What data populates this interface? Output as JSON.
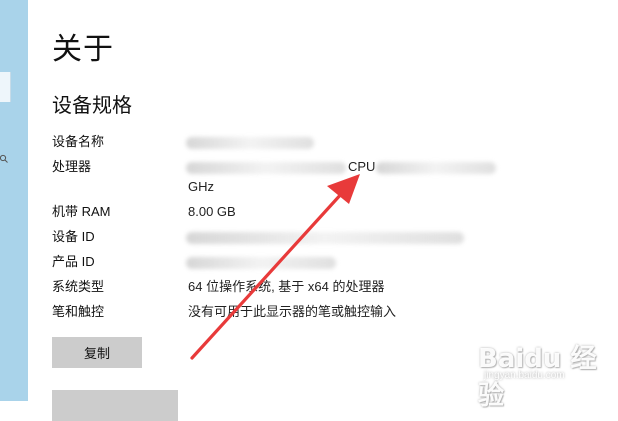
{
  "page": {
    "title": "关于"
  },
  "specs": {
    "section_title": "设备规格",
    "rows": [
      {
        "label": "设备名称",
        "value": ""
      },
      {
        "label": "处理器",
        "value": "CPU",
        "value_line2": "GHz"
      },
      {
        "label": "机带 RAM",
        "value": "8.00 GB"
      },
      {
        "label": "设备 ID",
        "value": ""
      },
      {
        "label": "产品 ID",
        "value": ""
      },
      {
        "label": "系统类型",
        "value": "64 位操作系统, 基于 x64 的处理器"
      },
      {
        "label": "笔和触控",
        "value": "没有可用于此显示器的笔或触控输入"
      }
    ]
  },
  "buttons": {
    "copy_label": "复制"
  },
  "annotation": {
    "arrow_color": "#e83a3a"
  },
  "watermark": {
    "main": "Baidu 经验",
    "sub": "jingyan.baidu.com"
  },
  "colors": {
    "sidebar": "#a9d3ea",
    "button": "#cccccc"
  }
}
